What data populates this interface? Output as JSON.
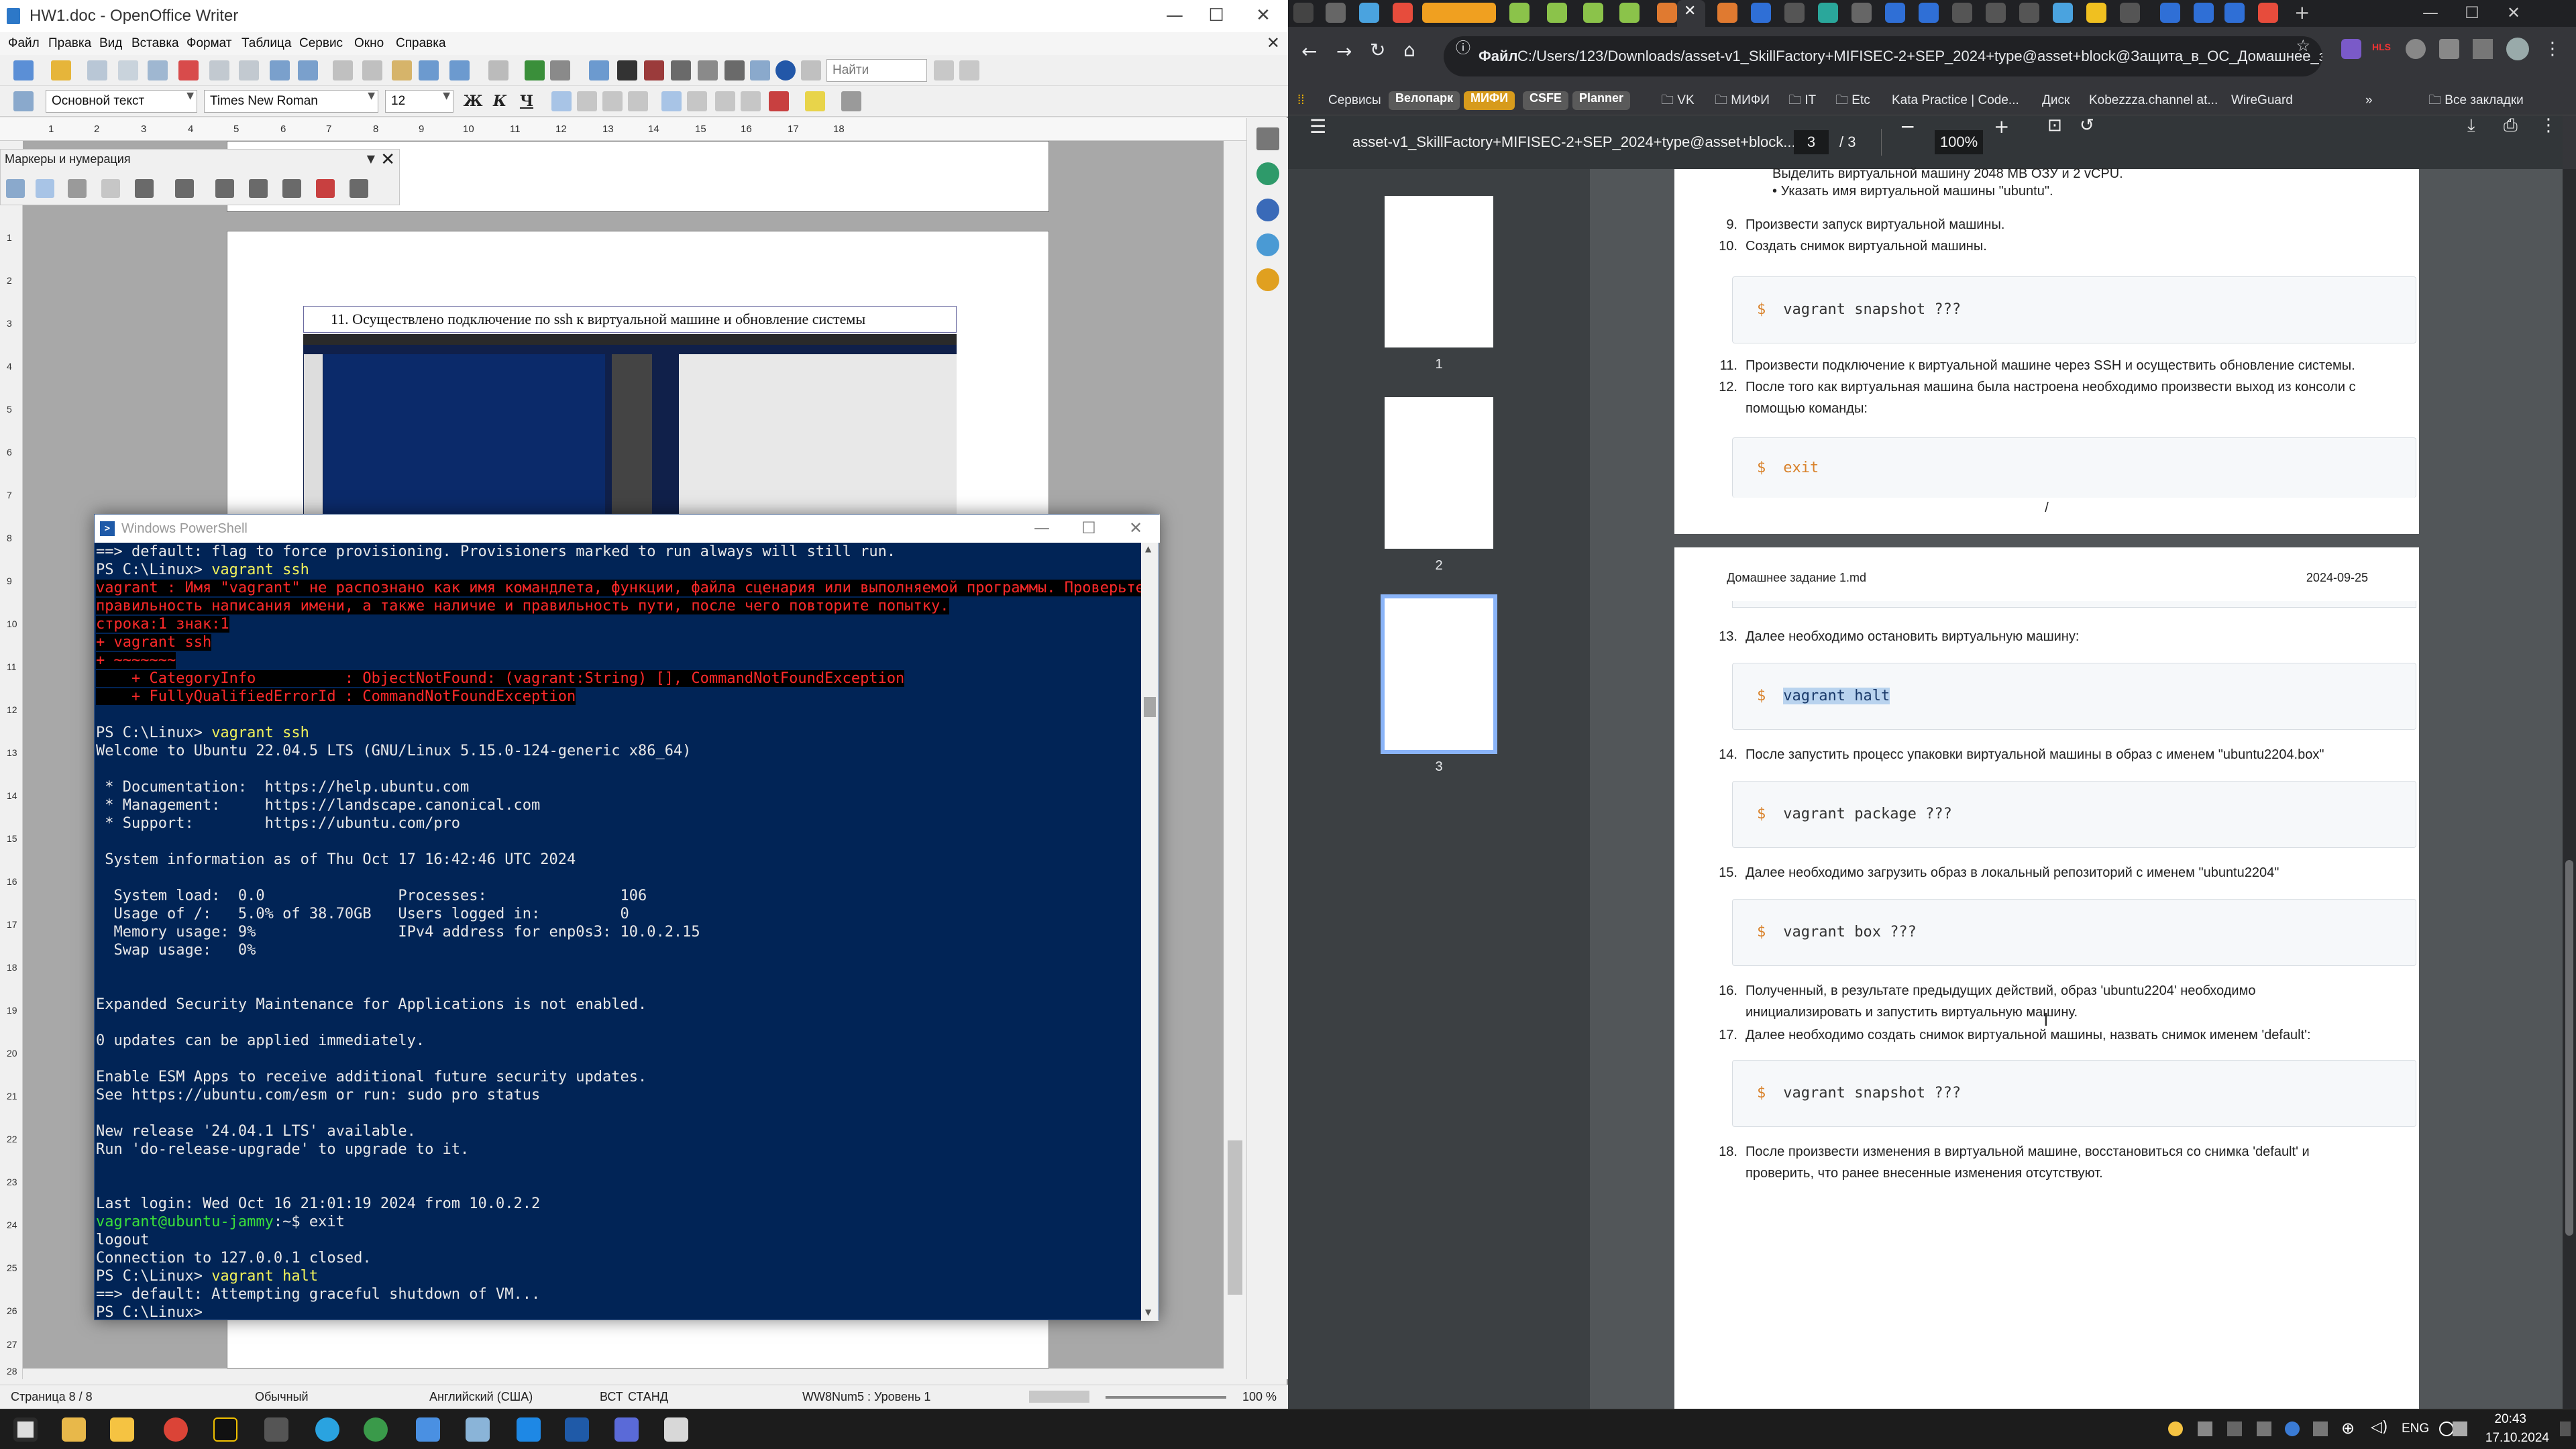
{
  "writer": {
    "title": "HW1.doc - OpenOffice Writer",
    "menu": [
      "Файл",
      "Правка",
      "Вид",
      "Вставка",
      "Формат",
      "Таблица",
      "Сервис",
      "Окно",
      "Справка"
    ],
    "find_placeholder": "Найти",
    "style": "Основной текст",
    "font": "Times New Roman",
    "size": "12",
    "bold": "Ж",
    "italic": "К",
    "underline": "Ч",
    "ruler": [
      "1",
      "2",
      "3",
      "4",
      "5",
      "6",
      "7",
      "8",
      "9",
      "10",
      "11",
      "12",
      "13",
      "14",
      "15",
      "16",
      "17",
      "18"
    ],
    "vruler": [
      "1",
      "2",
      "3",
      "4",
      "5",
      "6",
      "7",
      "8",
      "9",
      "10",
      "11",
      "12",
      "13",
      "14",
      "15",
      "16",
      "17",
      "18",
      "19",
      "20",
      "21",
      "22",
      "23",
      "24",
      "25",
      "26",
      "27",
      "28"
    ],
    "panel_title": "Маркеры и нумерация",
    "doc_heading": "11.  Осуществлено подключение по ssh к виртуальной машине и обновление системы",
    "status": {
      "page": "Страница  8 / 8",
      "style": "Обычный",
      "lang": "Английский (США)",
      "ins": "ВСТ",
      "std": "СТАНД",
      "list": "WW8Num5 : Уровень  1",
      "zoom": "100 %"
    }
  },
  "powershell": {
    "title": "Windows PowerShell",
    "lines": [
      {
        "t": "==> default: flag to force provisioning. Provisioners marked to run always will still run.",
        "c": ""
      },
      {
        "p": "PS C:\\Linux> ",
        "y": "vagrant ssh"
      },
      {
        "t": "vagrant : Имя \"vagrant\" не распознано как имя командлета, функции, файла сценария или выполняемой программы. Проверьте",
        "c": "err"
      },
      {
        "t": "правильность написания имени, а также наличие и правильность пути, после чего повторите попытку.",
        "c": "err"
      },
      {
        "t": "строка:1 знак:1",
        "c": "err"
      },
      {
        "t": "+ vagrant ssh",
        "c": "err"
      },
      {
        "t": "+ ~~~~~~~",
        "c": "err"
      },
      {
        "t": "    + CategoryInfo          : ObjectNotFound: (vagrant:String) [], CommandNotFoundException",
        "c": "err"
      },
      {
        "t": "    + FullyQualifiedErrorId : CommandNotFoundException",
        "c": "err"
      },
      {
        "t": " ",
        "c": ""
      },
      {
        "p": "PS C:\\Linux> ",
        "y": "vagrant ssh"
      },
      {
        "t": "Welcome to Ubuntu 22.04.5 LTS (GNU/Linux 5.15.0-124-generic x86_64)",
        "c": ""
      },
      {
        "t": " ",
        "c": ""
      },
      {
        "t": " * Documentation:  https://help.ubuntu.com",
        "c": ""
      },
      {
        "t": " * Management:     https://landscape.canonical.com",
        "c": ""
      },
      {
        "t": " * Support:        https://ubuntu.com/pro",
        "c": ""
      },
      {
        "t": " ",
        "c": ""
      },
      {
        "t": " System information as of Thu Oct 17 16:42:46 UTC 2024",
        "c": ""
      },
      {
        "t": " ",
        "c": ""
      },
      {
        "t": "  System load:  0.0               Processes:               106",
        "c": ""
      },
      {
        "t": "  Usage of /:   5.0% of 38.70GB   Users logged in:         0",
        "c": ""
      },
      {
        "t": "  Memory usage: 9%                IPv4 address for enp0s3: 10.0.2.15",
        "c": ""
      },
      {
        "t": "  Swap usage:   0%",
        "c": ""
      },
      {
        "t": " ",
        "c": ""
      },
      {
        "t": " ",
        "c": ""
      },
      {
        "t": "Expanded Security Maintenance for Applications is not enabled.",
        "c": ""
      },
      {
        "t": " ",
        "c": ""
      },
      {
        "t": "0 updates can be applied immediately.",
        "c": ""
      },
      {
        "t": " ",
        "c": ""
      },
      {
        "t": "Enable ESM Apps to receive additional future security updates.",
        "c": ""
      },
      {
        "t": "See https://ubuntu.com/esm or run: sudo pro status",
        "c": ""
      },
      {
        "t": " ",
        "c": ""
      },
      {
        "t": "New release '24.04.1 LTS' available.",
        "c": ""
      },
      {
        "t": "Run 'do-release-upgrade' to upgrade to it.",
        "c": ""
      },
      {
        "t": " ",
        "c": ""
      },
      {
        "t": " ",
        "c": ""
      },
      {
        "t": "Last login: Wed Oct 16 21:01:19 2024 from 10.0.2.2",
        "c": ""
      },
      {
        "g": "vagrant@ubuntu-jammy",
        "t": ":~$ exit"
      },
      {
        "t": "logout",
        "c": ""
      },
      {
        "t": "Connection to 127.0.0.1 closed.",
        "c": ""
      },
      {
        "p": "PS C:\\Linux> ",
        "y": "vagrant halt"
      },
      {
        "t": "==> default: Attempting graceful shutdown of VM...",
        "c": ""
      },
      {
        "t": "PS C:\\Linux>",
        "c": ""
      }
    ]
  },
  "browser": {
    "url_prefix": "Файл",
    "url": "C:/Users/123/Downloads/asset-v1_SkillFactory+MIFISEC-2+SEP_2024+type@asset+block@Защита_в_ОС_Домашнее_за...",
    "bookmarks": [
      "Сервисы",
      "Велопарк",
      "МИФИ",
      "CSFE",
      "Planner",
      "VK",
      "МИФИ",
      "IT",
      "Etc",
      "Kata Practice | Code...",
      "Диск",
      "Kobezzza.channel at...",
      "WireGuard",
      "Все закладки"
    ],
    "pdf": {
      "filename": "asset-v1_SkillFactory+MIFISEC-2+SEP_2024+type@asset+block...",
      "page": "3",
      "pages": "/  3",
      "zoom": "100%",
      "thumbs": [
        "1",
        "2",
        "3"
      ],
      "p2_top_item": "Выделить виртуальной машину 2048 MB ОЗУ и 2 vCPU.",
      "p2_items": [
        {
          "n": "",
          "t": "Указать имя виртуальной машины \"ubuntu\"."
        },
        {
          "n": "9.",
          "t": "Произвести запуск виртуальной машины."
        },
        {
          "n": "10.",
          "t": "Создать снимок виртуальной машины."
        }
      ],
      "code1": "vagrant snapshot ???",
      "p2_items2": [
        {
          "n": "11.",
          "t": "Произвести подключение к виртуальной машине через SSH и осуществить обновление системы."
        },
        {
          "n": "12.",
          "t": "После того как виртуальная машина была настроена необходимо произвести выход из консоли с"
        },
        {
          "n": "",
          "t": "помощью команды:"
        }
      ],
      "code2": "exit",
      "page_footer": "/",
      "p3_header_left": "Домашнее задание 1.md",
      "p3_header_right": "2024-09-25",
      "item13": "Далее необходимо остановить виртуальную машину:",
      "code3": "vagrant halt",
      "item14": "После запустить процесс упаковки виртуальной машины в образ с именем \"ubuntu2204.box\"",
      "code4": "vagrant package ???",
      "item15": "Далее необходимо загрузить образ в локальный репозиторий с именем \"ubuntu2204\"",
      "code5": "vagrant box ???",
      "item16a": "Полученный, в результате предыдущих действий, образ 'ubuntu2204' необходимо",
      "item16b": "инициализировать и запустить виртуальную машину.",
      "item17": "Далее необходимо создать снимок виртуальной машины, назвать снимок именем 'default':",
      "code6": "vagrant snapshot ???",
      "item18a": "После произвести изменения в виртуальной машине, восстановиться со снимка 'default' и",
      "item18b": "проверить, что ранее внесенные изменения отсутствуют.",
      "nums": [
        "13.",
        "14.",
        "15.",
        "16.",
        "17.",
        "18."
      ]
    }
  },
  "taskbar": {
    "lang": "ENG",
    "time": "20:43",
    "date": "17.10.2024"
  },
  "colors": {
    "ps_bg": "#012456",
    "ps_err": "#ff2a2a",
    "ps_yellow": "#f3f35a",
    "accent": "#1a73e8"
  }
}
